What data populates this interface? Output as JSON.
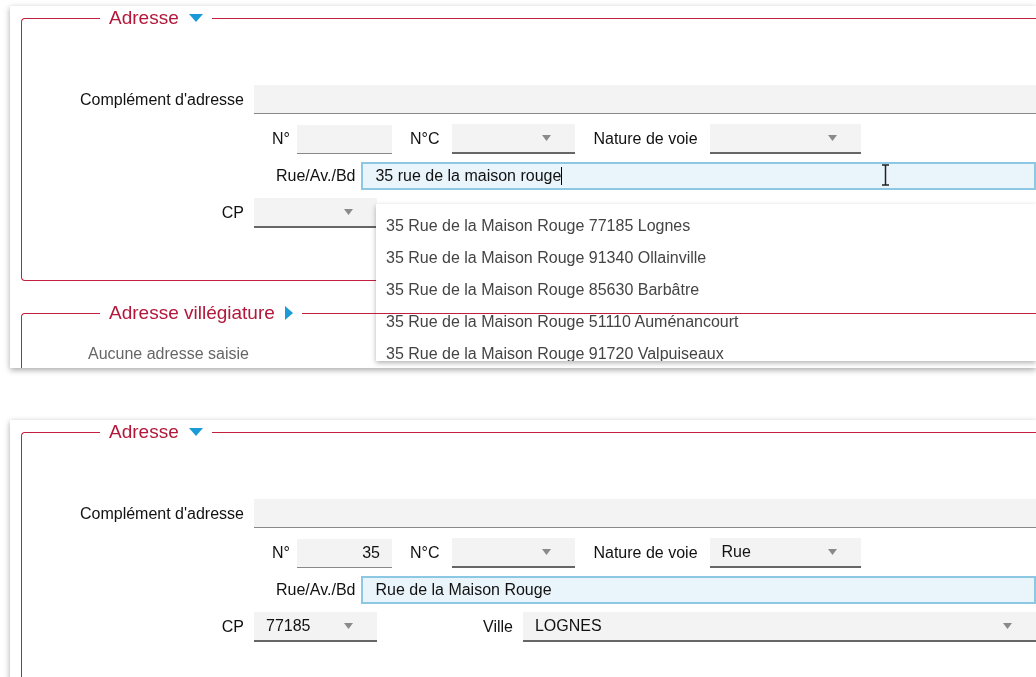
{
  "panels": [
    {
      "address_section": {
        "title": "Adresse",
        "expanded": true,
        "complement": {
          "label": "Complément d'adresse"
        },
        "number": {
          "label": "N°"
        },
        "number_complement": {
          "label": "N°C"
        },
        "street_type": {
          "label": "Nature de voie"
        },
        "street": {
          "label": "Rue/Av./Bd",
          "value": "35 rue de la maison rouge",
          "focused": true
        },
        "postcode": {
          "label": "CP"
        },
        "suggestions": [
          "35 Rue de la Maison Rouge 77185 Lognes",
          "35 Rue de la Maison Rouge 91340 Ollainville",
          "35 Rue de la Maison Rouge 85630 Barbâtre",
          "35 Rue de la Maison Rouge 51110 Auménancourt",
          "35 Rue de la Maison Rouge 91720 Valpuiseaux"
        ]
      },
      "secondary_section": {
        "title": "Adresse villégiature",
        "expanded": false,
        "empty_text": "Aucune adresse saisie"
      }
    },
    {
      "address_section": {
        "title": "Adresse",
        "expanded": true,
        "complement": {
          "label": "Complément d'adresse"
        },
        "number": {
          "label": "N°",
          "value": "35"
        },
        "number_complement": {
          "label": "N°C"
        },
        "street_type": {
          "label": "Nature de voie",
          "value": "Rue"
        },
        "street": {
          "label": "Rue/Av./Bd",
          "value": "Rue de la Maison Rouge",
          "focused": true
        },
        "postcode": {
          "label": "CP",
          "value": "77185"
        },
        "city": {
          "label": "Ville",
          "value": "LOGNES"
        }
      }
    }
  ]
}
